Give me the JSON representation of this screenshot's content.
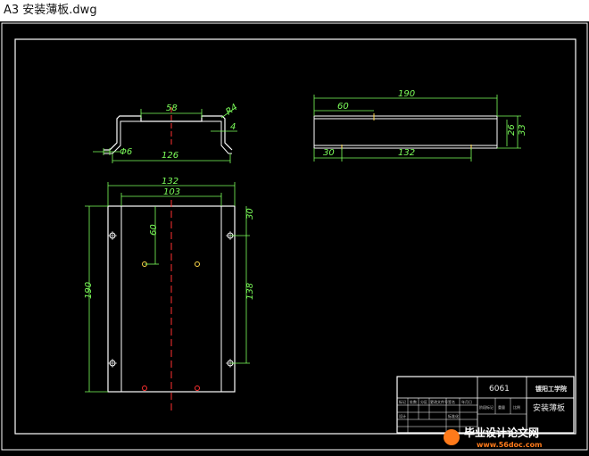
{
  "window": {
    "title": "A3 安装薄板.dwg"
  },
  "dims": {
    "d58": "58",
    "r4": "R4",
    "t4": "4",
    "phi6": "Φ6",
    "d126": "126",
    "d190_top": "190",
    "d60_top": "60",
    "d26": "26",
    "d33": "33",
    "d30_bottom": "30",
    "d132_side": "132",
    "d132_front": "132",
    "d103": "103",
    "d30_front": "30",
    "d60_front": "60",
    "d190_front": "190",
    "d138": "138"
  },
  "title_block": {
    "material": "6061",
    "school": "镀阳工学院",
    "part_name": "安装薄板",
    "row_labels": [
      "标记",
      "处数",
      "分区",
      "更改文件号",
      "签名",
      "年月日"
    ],
    "design_label": "设计",
    "std_label": "标准化",
    "stage_label": "阶段标记",
    "weight_label": "重量",
    "scale_label": "比例"
  },
  "watermark": {
    "text": "毕业设计论文网",
    "url": "www.56doc.com"
  },
  "colors": {
    "line": "#ffffff",
    "dimension": "#7cff5a",
    "center": "#ff3030",
    "part": "#ffffff",
    "hole": "#ffd94a"
  }
}
